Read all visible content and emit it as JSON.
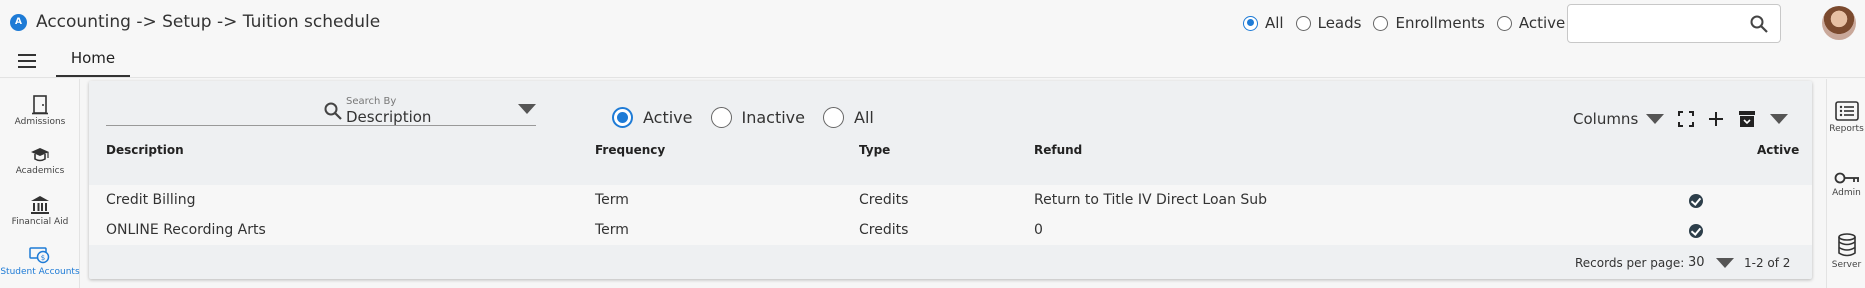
{
  "header": {
    "logo_text": "A",
    "breadcrumb": "Accounting -> Setup -> Tuition schedule",
    "filter_options": [
      {
        "label": "All",
        "selected": true
      },
      {
        "label": "Leads",
        "selected": false
      },
      {
        "label": "Enrollments",
        "selected": false
      },
      {
        "label": "Active",
        "selected": false
      }
    ],
    "search_placeholder": ""
  },
  "tabs": {
    "items": [
      {
        "label": "Home",
        "active": true
      }
    ]
  },
  "left_nav": {
    "items": [
      {
        "label": "Admissions",
        "icon": "door-icon",
        "active": false
      },
      {
        "label": "Academics",
        "icon": "graduation-cap-icon",
        "active": false
      },
      {
        "label": "Financial Aid",
        "icon": "bank-icon",
        "active": false
      },
      {
        "label": "Student Accounts",
        "icon": "money-icon",
        "active": true
      }
    ]
  },
  "right_nav": {
    "items": [
      {
        "label": "Reports",
        "icon": "list-icon"
      },
      {
        "label": "Admin",
        "icon": "key-icon"
      },
      {
        "label": "Server",
        "icon": "database-icon"
      }
    ]
  },
  "panel": {
    "search_by_label": "Search By",
    "search_by_value": "Description",
    "status_filter": [
      {
        "label": "Active",
        "selected": true
      },
      {
        "label": "Inactive",
        "selected": false
      },
      {
        "label": "All",
        "selected": false
      }
    ],
    "columns_label": "Columns",
    "table": {
      "headers": [
        "Description",
        "Frequency",
        "Type",
        "Refund",
        "Active"
      ],
      "rows": [
        {
          "description": "Credit Billing",
          "frequency": "Term",
          "type": "Credits",
          "refund": "Return to Title IV Direct Loan Sub",
          "active": true
        },
        {
          "description": "ONLINE Recording Arts",
          "frequency": "Term",
          "type": "Credits",
          "refund": "0",
          "active": true
        }
      ]
    },
    "footer": {
      "records_per_page_label": "Records per page:",
      "records_per_page": "30",
      "range": "1-2 of 2"
    }
  },
  "colors": {
    "accent": "#1e7bd6",
    "check": "#2d3e4a"
  }
}
